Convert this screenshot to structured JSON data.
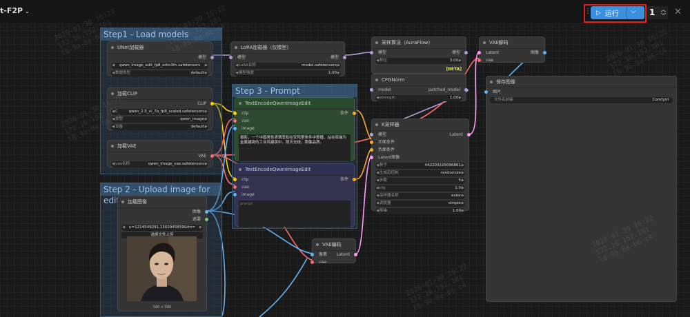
{
  "app": {
    "title": "t-F2P"
  },
  "toolbar": {
    "run_label": "运行",
    "queue_count": "1"
  },
  "groups": {
    "step1": "Step1 - Load models",
    "step2": "Step 2 - Upload image for editing",
    "step3": "Step 3 - Prompt"
  },
  "nodes": {
    "unet": {
      "title": "UNet加载器",
      "out_model": "模型",
      "name": "qwen_image_edit_fp8_e4m3fn.safetensors",
      "dtype_label": "数据类型",
      "dtype_value": "default"
    },
    "clip": {
      "title": "加载CLIP",
      "out_clip": "CLIP",
      "name_prefix": "C",
      "name": "qwen_2.5_vl_7b_fp8_scaled.safetensors",
      "type_label": "类型",
      "type_value": "qwen_image",
      "device_label": "设备",
      "device_value": "default"
    },
    "vae_loader": {
      "title": "加载VAE",
      "out_vae": "VAE",
      "name_label": "vae名称",
      "name": "qwen_image_vae.safetensors"
    },
    "lora": {
      "title": "LoRA加载器（仅模型）",
      "in_model": "模型",
      "out_model": "模型",
      "name_label": "LoRA名称",
      "name": "model.safetensors",
      "strength_label": "模型强度",
      "strength": "1.00"
    },
    "aura": {
      "title": "采样算法（AuraFlow）",
      "in_model": "模型",
      "out_model": "模型",
      "shift_label": "移位",
      "shift": "3.00",
      "badge": "[BETA]"
    },
    "cfgnorm": {
      "title": "CFGNorm",
      "in_model": "model",
      "out_model": "patched_model",
      "strength_label": "strength",
      "strength": "1.00"
    },
    "vae_decode": {
      "title": "VAE解码",
      "in_latent": "Latent",
      "in_vae": "vae",
      "out_image": "图像"
    },
    "save": {
      "title": "保存图像",
      "in_images": "图片",
      "prefix_label": "文件名前缀",
      "prefix": "ComfyUI"
    },
    "te1": {
      "title": "TextEncodeQwenImageEdit",
      "in_clip": "clip",
      "in_vae": "vae",
      "in_image": "image",
      "out": "条件",
      "prompt": "摄影，一个中国男性表情宽松在安阳里条件中登播，站在街端为金属建筑的工业风建筑中，阴天光线，照像品质。"
    },
    "te2": {
      "title": "TextEncodeQwenImageEdit",
      "in_clip": "clip",
      "in_vae": "vae",
      "in_image": "image",
      "out": "条件",
      "placeholder": "prompt"
    },
    "ksampler": {
      "title": "K采样器",
      "in_model": "模型",
      "in_pos": "正面条件",
      "in_neg": "负面条件",
      "in_latent": "Latent图像",
      "out": "Latent",
      "rows": [
        {
          "label": "种子",
          "value": "442203225096861"
        },
        {
          "label": "生成后控制",
          "value": "randomize"
        },
        {
          "label": "步数",
          "value": "5"
        },
        {
          "label": "cfg",
          "value": "1.0"
        },
        {
          "label": "采样器名称",
          "value": "euler"
        },
        {
          "label": "调度器",
          "value": "simple"
        },
        {
          "label": "降噪",
          "value": "1.00"
        }
      ]
    },
    "load_image": {
      "title": "加载图像",
      "out_image": "图像",
      "out_mask": "遮罩",
      "file": "u=1214549291,1502945659&fm=",
      "upload": "选择文件上传",
      "size": "580 × 580"
    },
    "vae_encode": {
      "title": "VAE编码",
      "in_pixels": "像素",
      "in_vae": "vae",
      "out": "Latent"
    }
  },
  "colors": {
    "accent": "#3b8fe0",
    "highlight": "#e02020",
    "model_link": "#b39ddb",
    "clip_link": "#ffd500",
    "vae_link": "#ff6e6e",
    "image_link": "#64b5f6",
    "latent_link": "#ff9cf9",
    "cond_link": "#ffa931"
  },
  "watermark": "2026-01-30 16:22\n172.16.152.101\nl8-9a-8e-b6-c4"
}
